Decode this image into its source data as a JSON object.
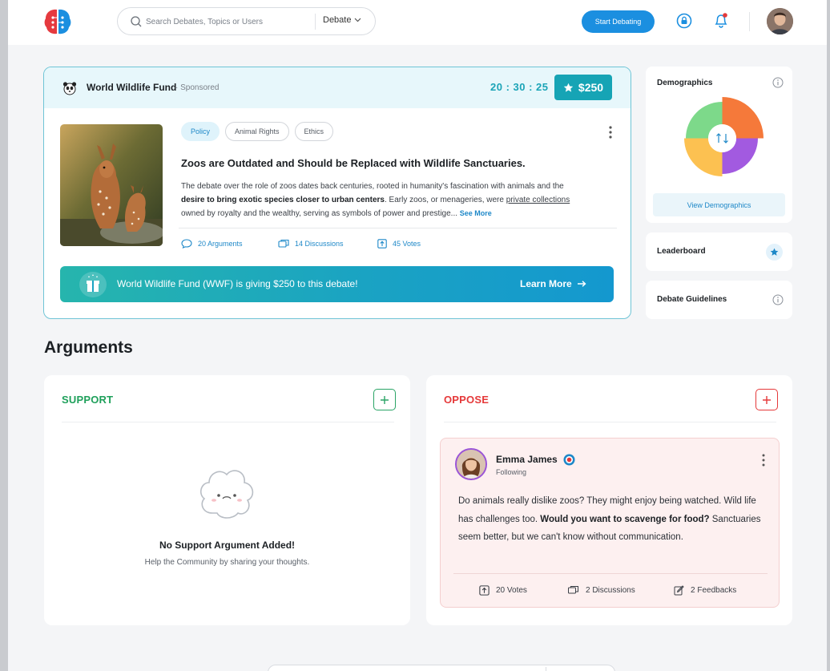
{
  "header": {
    "search_placeholder": "Search Debates, Topics or Users",
    "search_filter": "Debate",
    "start_button": "Start Debating",
    "logo_icon": "brain-logo-icon",
    "icons": [
      "search-icon",
      "chevron-down-icon",
      "lock-chat-icon",
      "bell-icon",
      "user-avatar"
    ]
  },
  "debate": {
    "org_name": "World Wildlife Fund",
    "sponsored_label": "· Sponsored",
    "timer": "20 : 30 : 25",
    "prize": "$250",
    "tags": [
      {
        "label": "Policy",
        "active": true
      },
      {
        "label": "Animal Rights",
        "active": false
      },
      {
        "label": "Ethics",
        "active": false
      }
    ],
    "title": "Zoos are Outdated and Should be Replaced with Wildlife Sanctuaries.",
    "desc_part1": "The debate over the role of zoos dates back centuries, rooted in humanity's fascination with animals and the ",
    "desc_bold": "desire to bring exotic species closer to urban centers",
    "desc_part2": ". Early zoos, or menageries, were ",
    "desc_underline": "private collections",
    "desc_part3": " owned by royalty and the wealthy, serving as symbols of power and prestige... ",
    "see_more": "See More",
    "stats": {
      "arguments": "20 Arguments",
      "discussions": "14 Discussions",
      "votes": "45 Votes"
    },
    "banner_text": "World Wildlife Fund (WWF) is giving $250 to this debate!",
    "banner_cta": "Learn More"
  },
  "sidebar": {
    "demographics_title": "Demographics",
    "view_demographics": "View Demographics",
    "leaderboard": "Leaderboard",
    "guidelines": "Debate Guidelines",
    "donut_colors": [
      "#f5793a",
      "#a25ae0",
      "#fcc151",
      "#7dd98a"
    ]
  },
  "arguments": {
    "heading": "Arguments",
    "support": {
      "label": "SUPPORT",
      "empty_title": "No Support Argument Added!",
      "empty_sub": "Help the  Community by sharing your thoughts."
    },
    "oppose": {
      "label": "OPPOSE",
      "card": {
        "name": "Emma James",
        "status": "Following",
        "text_part1": "Do animals really dislike zoos? They might enjoy being watched. Wild life has challenges too. ",
        "text_bold": "Would you want to scavenge for food?",
        "text_part2": " Sanctuaries seem better, but we can't know without communication.",
        "votes": "20 Votes",
        "discussions": "2 Discussions",
        "feedbacks": "2 Feedbacks"
      }
    }
  },
  "colors": {
    "accent": "#1b8fe0",
    "teal": "#16a4b5",
    "support": "#1fa05b",
    "oppose": "#e5393a"
  }
}
